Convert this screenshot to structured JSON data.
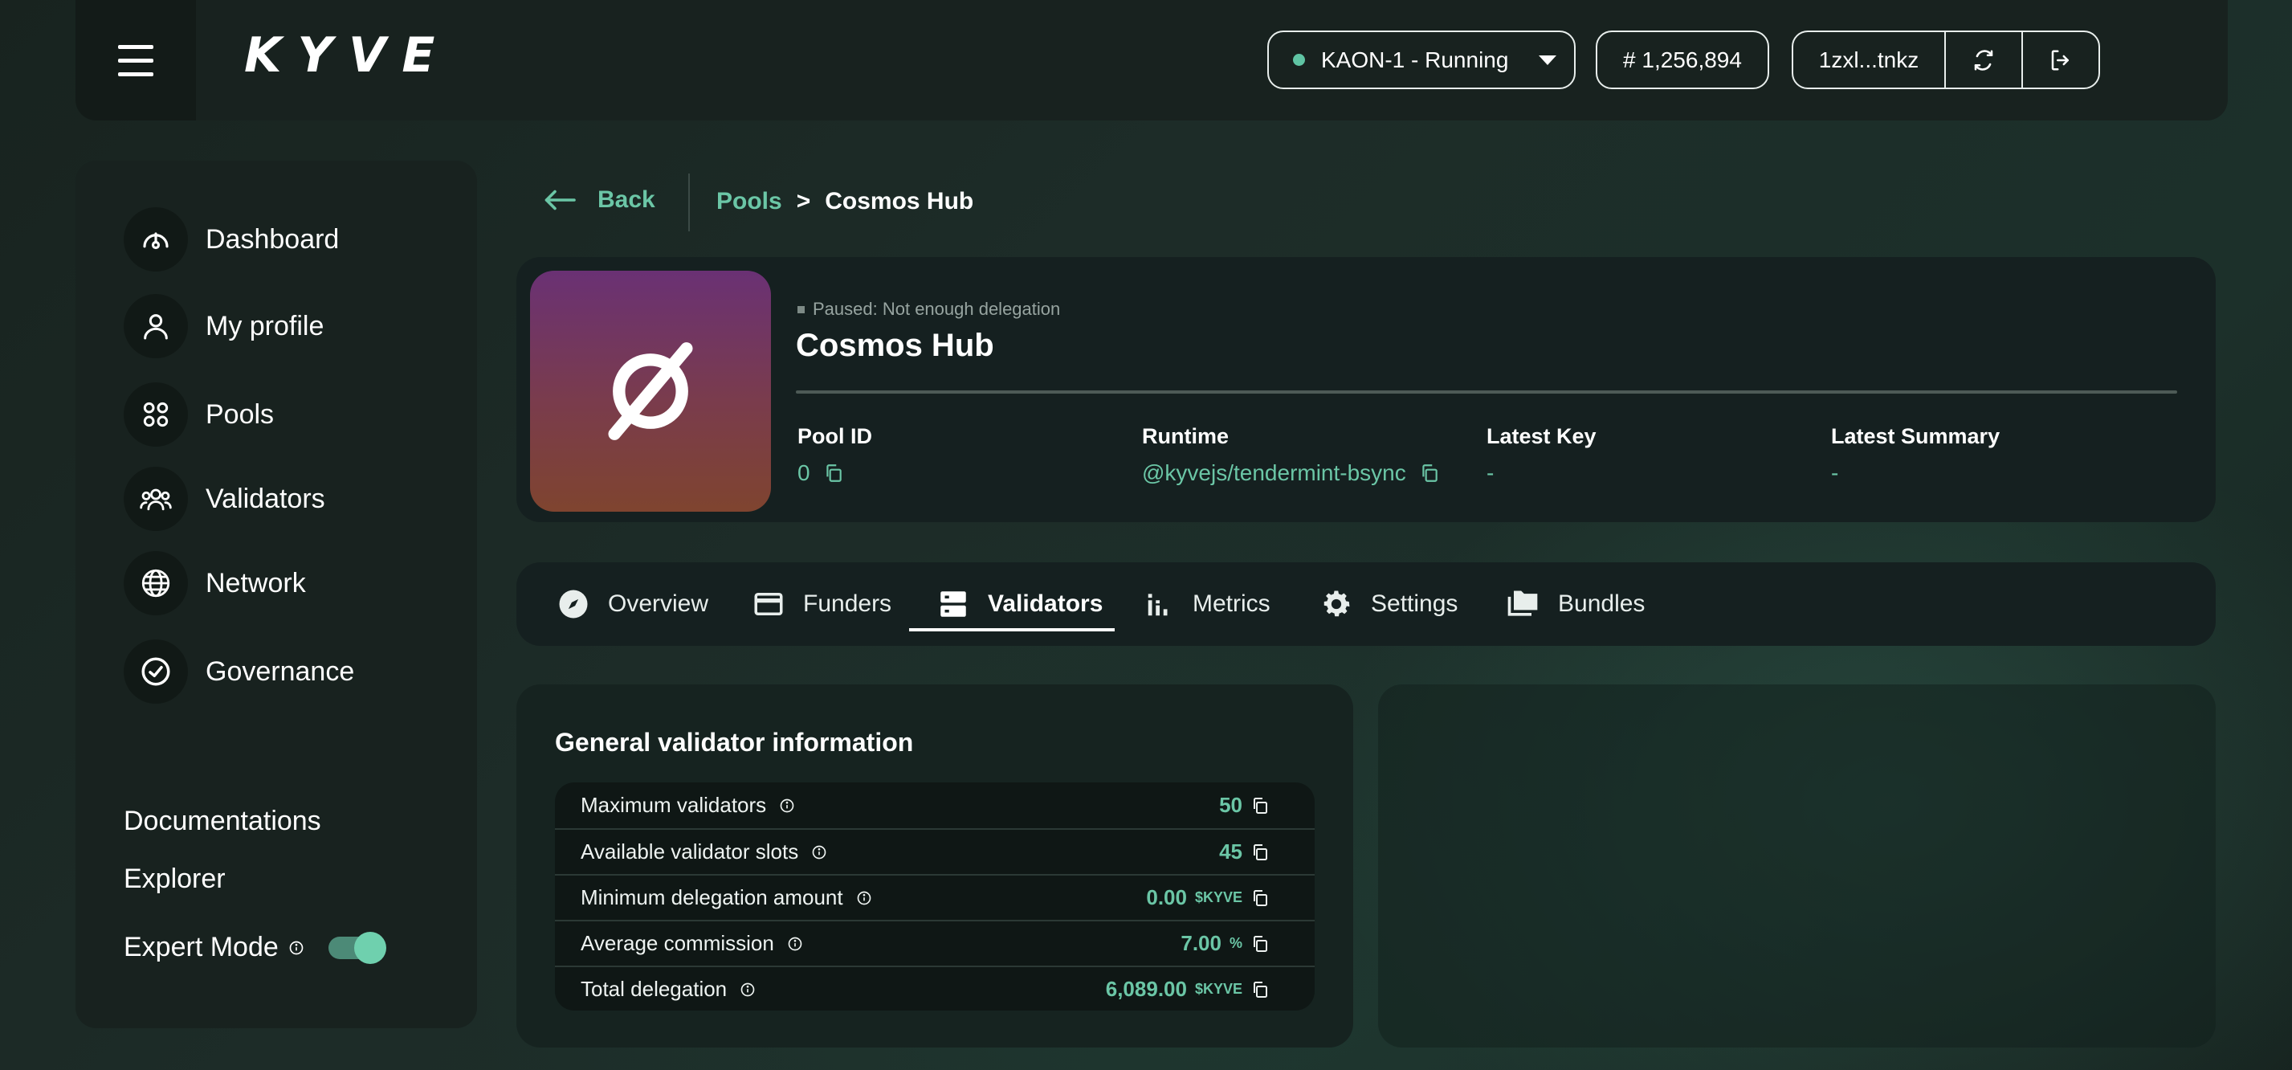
{
  "header": {
    "logo": "KYVE",
    "network_status": "KAON-1 - Running",
    "block_height": "# 1,256,894",
    "wallet_address": "1zxl...tnkz"
  },
  "sidebar": {
    "items": [
      {
        "label": "Dashboard",
        "icon": "gauge-icon"
      },
      {
        "label": "My profile",
        "icon": "user-icon"
      },
      {
        "label": "Pools",
        "icon": "pools-grid-icon"
      },
      {
        "label": "Validators",
        "icon": "users-group-icon"
      },
      {
        "label": "Network",
        "icon": "globe-icon"
      },
      {
        "label": "Governance",
        "icon": "check-circle-icon"
      }
    ],
    "links": [
      "Documentations",
      "Explorer"
    ],
    "expert_mode_label": "Expert Mode",
    "expert_mode_on": true
  },
  "breadcrumb": {
    "back_label": "Back",
    "parent": "Pools",
    "separator": ">",
    "current": "Cosmos Hub"
  },
  "pool": {
    "status": "Paused: Not enough delegation",
    "name": "Cosmos Hub",
    "meta": [
      {
        "label": "Pool ID",
        "value": "0"
      },
      {
        "label": "Runtime",
        "value": "@kyvejs/tendermint-bsync"
      },
      {
        "label": "Latest Key",
        "value": "-"
      },
      {
        "label": "Latest Summary",
        "value": "-"
      }
    ]
  },
  "tabs": {
    "items": [
      "Overview",
      "Funders",
      "Validators",
      "Metrics",
      "Settings",
      "Bundles"
    ],
    "active": "Validators"
  },
  "validator_info": {
    "title": "General validator information",
    "rows": [
      {
        "label": "Maximum validators",
        "value": "50",
        "unit": ""
      },
      {
        "label": "Available validator slots",
        "value": "45",
        "unit": ""
      },
      {
        "label": "Minimum delegation amount",
        "value": "0.00",
        "unit": "$KYVE"
      },
      {
        "label": "Average commission",
        "value": "7.00",
        "unit": "%"
      },
      {
        "label": "Total delegation",
        "value": "6,089.00",
        "unit": "$KYVE"
      }
    ]
  },
  "colors": {
    "accent": "#6bc6a6",
    "background": "#1d2c28",
    "card": "#152020",
    "pool_logo_top": "#6a3174",
    "pool_logo_bottom": "#7f442f"
  }
}
